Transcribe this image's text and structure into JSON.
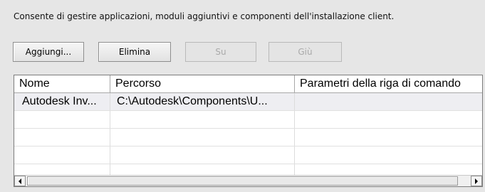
{
  "description": "Consente di gestire applicazioni, moduli aggiuntivi e componenti dell'installazione client.",
  "buttons": {
    "add": "Aggiungi...",
    "delete": "Elimina",
    "up": "Su",
    "down": "Giù"
  },
  "table": {
    "headers": [
      "Nome",
      "Percorso",
      "Parametri della riga di comando"
    ],
    "rows": [
      [
        "Autodesk Inv...",
        "C:\\Autodesk\\Components\\U...",
        ""
      ],
      [
        "",
        "",
        ""
      ],
      [
        "",
        "",
        ""
      ],
      [
        "",
        "",
        ""
      ],
      [
        "",
        "",
        ""
      ]
    ]
  },
  "icons": {
    "scroll_left": "arrow-left-icon",
    "scroll_right": "arrow-right-icon"
  }
}
